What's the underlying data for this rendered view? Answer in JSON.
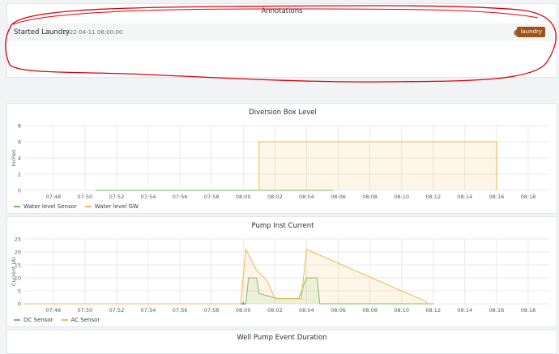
{
  "annotations_panel": {
    "title": "Annotations",
    "item": {
      "title": "Started Laundry",
      "time": "2022-04-11 08:00:00",
      "tag": "laundry",
      "tag_color": "#a0511a"
    },
    "highlight_color": "#e0000b"
  },
  "diversion_panel": {
    "legend": [
      {
        "name": "Water level Sensor",
        "color": "#73bf69"
      },
      {
        "name": "Water level GW",
        "color": "#f2b84f"
      }
    ]
  },
  "pump_panel": {
    "legend": [
      {
        "name": "DC Sensor",
        "color": "#73bf69"
      },
      {
        "name": "AC Sensor",
        "color": "#f2b84f"
      }
    ]
  },
  "bottom_panel": {
    "title": "Well Pump Event Duration"
  },
  "chart_data": [
    {
      "type": "area",
      "title": "Diversion Box Level",
      "ylabel": "Inches",
      "xlabel": "",
      "x_ticks": [
        "07:48",
        "07:50",
        "07:52",
        "07:54",
        "07:56",
        "07:58",
        "08:00",
        "08:02",
        "08:04",
        "08:06",
        "08:08",
        "08:10",
        "08:12",
        "08:14",
        "08:16",
        "08:18"
      ],
      "x_range": [
        "07:46:10",
        "08:19:20"
      ],
      "y_ticks": [
        0,
        2,
        4,
        6,
        8
      ],
      "ylim": [
        0,
        8
      ],
      "grid": true,
      "legend": "bottom-left",
      "series": [
        {
          "name": "Water level Sensor",
          "color": "#73bf69",
          "fill": false,
          "points": [
            [
              "07:50:40",
              0
            ],
            [
              "08:05:40",
              0
            ]
          ]
        },
        {
          "name": "Water level GW",
          "color": "#f2b84f",
          "fill": true,
          "points": [
            [
              "08:01:00",
              0
            ],
            [
              "08:01:00",
              6
            ],
            [
              "08:16:00",
              6
            ],
            [
              "08:16:00",
              0
            ]
          ]
        }
      ]
    },
    {
      "type": "area",
      "title": "Pump Inst Current",
      "ylabel": "Current (A)",
      "xlabel": "",
      "x_ticks": [
        "07:48",
        "07:50",
        "07:52",
        "07:54",
        "07:56",
        "07:58",
        "08:00",
        "08:02",
        "08:04",
        "08:06",
        "08:08",
        "08:10",
        "08:12",
        "08:14",
        "08:16",
        "08:18"
      ],
      "x_range": [
        "07:46:10",
        "08:19:20"
      ],
      "y_ticks": [
        0,
        5,
        10,
        15,
        20,
        25
      ],
      "ylim": [
        0,
        25
      ],
      "grid": true,
      "legend": "bottom-left",
      "annotation_marker": "08:00:00",
      "series": [
        {
          "name": "DC Sensor",
          "color": "#73bf69",
          "fill": true,
          "points": [
            [
              "07:46:10",
              0
            ],
            [
              "08:00:10",
              0
            ],
            [
              "08:00:20",
              10
            ],
            [
              "08:00:50",
              10
            ],
            [
              "08:01:00",
              4
            ],
            [
              "08:02:10",
              2
            ],
            [
              "08:03:30",
              2
            ],
            [
              "08:04:00",
              10
            ],
            [
              "08:04:40",
              10
            ],
            [
              "08:04:50",
              0
            ],
            [
              "08:12:00",
              0
            ]
          ]
        },
        {
          "name": "AC Sensor",
          "color": "#f2b84f",
          "fill": true,
          "points": [
            [
              "07:46:10",
              0
            ],
            [
              "07:59:50",
              0
            ],
            [
              "08:00:10",
              21
            ],
            [
              "08:00:50",
              13
            ],
            [
              "08:01:30",
              9
            ],
            [
              "08:02:00",
              2
            ],
            [
              "08:03:40",
              2
            ],
            [
              "08:04:00",
              21
            ],
            [
              "08:11:30",
              1
            ],
            [
              "08:11:40",
              0
            ]
          ]
        }
      ]
    }
  ]
}
